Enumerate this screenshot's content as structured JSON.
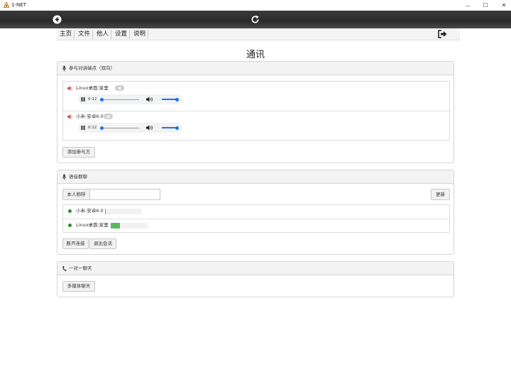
{
  "window": {
    "title": "1-NET",
    "minimize_glyph": "—",
    "maximize_glyph": "☐",
    "close_glyph": "✕"
  },
  "nav": {
    "items": [
      {
        "label": "主页"
      },
      {
        "label": "文件"
      },
      {
        "label": "他人"
      },
      {
        "label": "设置"
      },
      {
        "label": "说明"
      }
    ]
  },
  "page": {
    "title": "通讯"
  },
  "intercom": {
    "header": "参与对讲端点（双向）",
    "peers": [
      {
        "name": "Linux桌面:家里",
        "time": "0:12",
        "progress": 0,
        "volume": 1.0
      },
      {
        "name": "小米-安卓6.0",
        "time": "0:12",
        "progress": 0,
        "volume": 1.0
      }
    ],
    "add_button": "添加参与方"
  },
  "group_chat": {
    "header": "语音群聊",
    "nickname_label": "本人称呼",
    "nickname_value": "",
    "refresh_button": "更新",
    "members": [
      {
        "name": "小米-安卓6.0",
        "level": 0.02
      },
      {
        "name": "Linux桌面:家里",
        "level": 0.25
      }
    ],
    "disconnect_button": "断开连接",
    "leave_button": "退出会话"
  },
  "one_on_one": {
    "header": "一对一聊天",
    "media_button": "多媒体聊天"
  },
  "colors": {
    "toolbar": "#2e2e2e",
    "accent_blue": "#1a73e8",
    "speaker_red": "#d9534f",
    "online_green": "#2e8b2e",
    "level_green": "#5cb85c"
  }
}
